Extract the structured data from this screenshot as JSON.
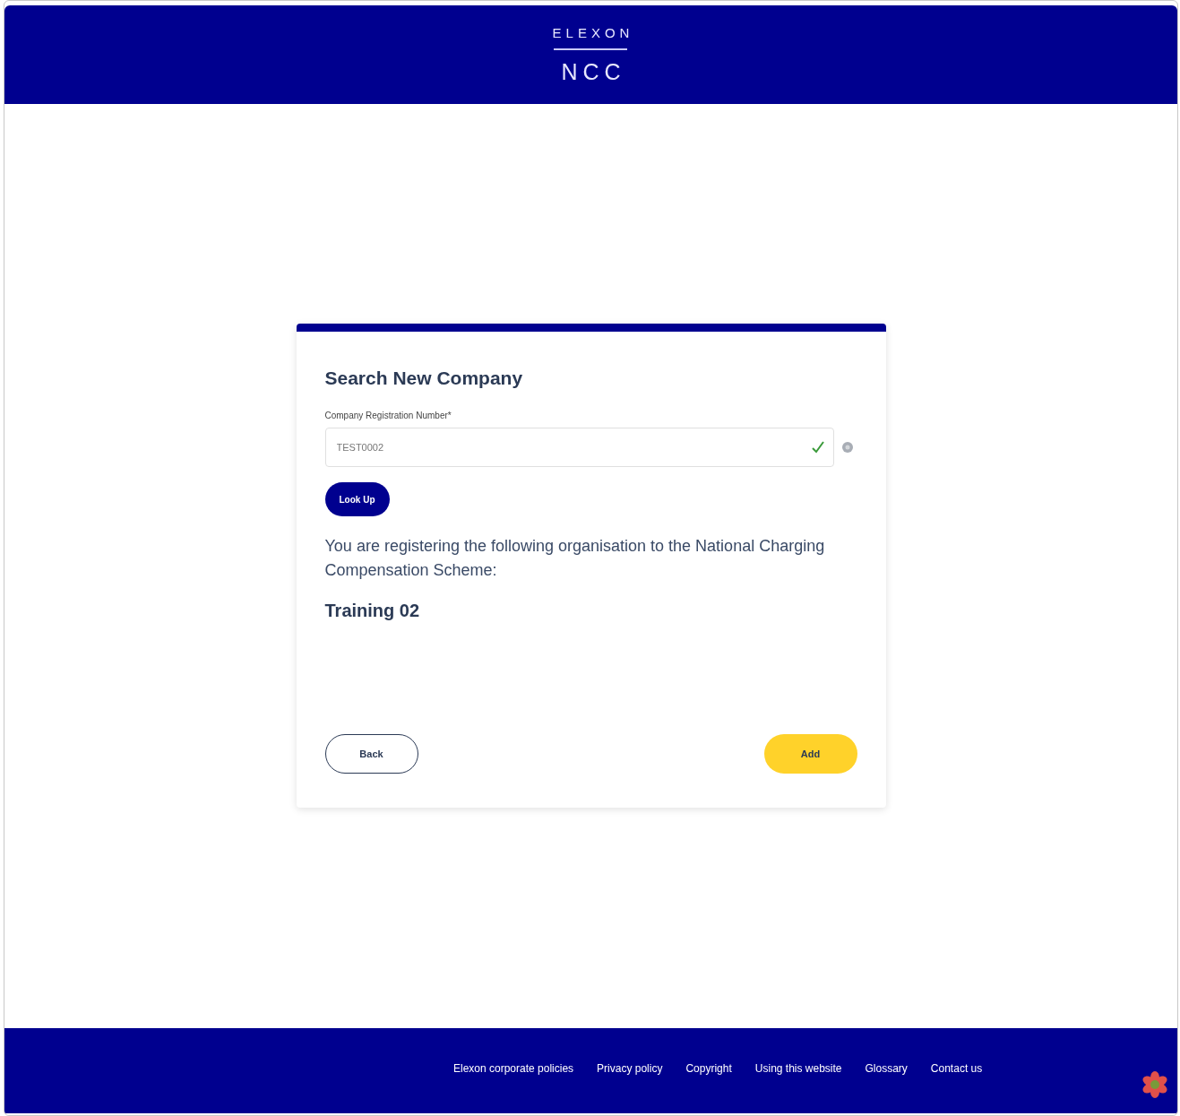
{
  "header": {
    "brand": "ELEXON",
    "product": "NCC"
  },
  "form": {
    "title": "Search New Company",
    "field": {
      "label": "Company Registration Number*",
      "value": "TEST0002",
      "valid": true
    },
    "lookup_button": "Look Up",
    "message": "You are registering the following organisation to the National Charging Compensation Scheme:",
    "company_name": "Training 02",
    "back_button": "Back",
    "add_button": "Add"
  },
  "footer": {
    "links": [
      "Elexon corporate policies",
      "Privacy policy",
      "Copyright",
      "Using this website",
      "Glossary",
      "Contact us"
    ]
  }
}
